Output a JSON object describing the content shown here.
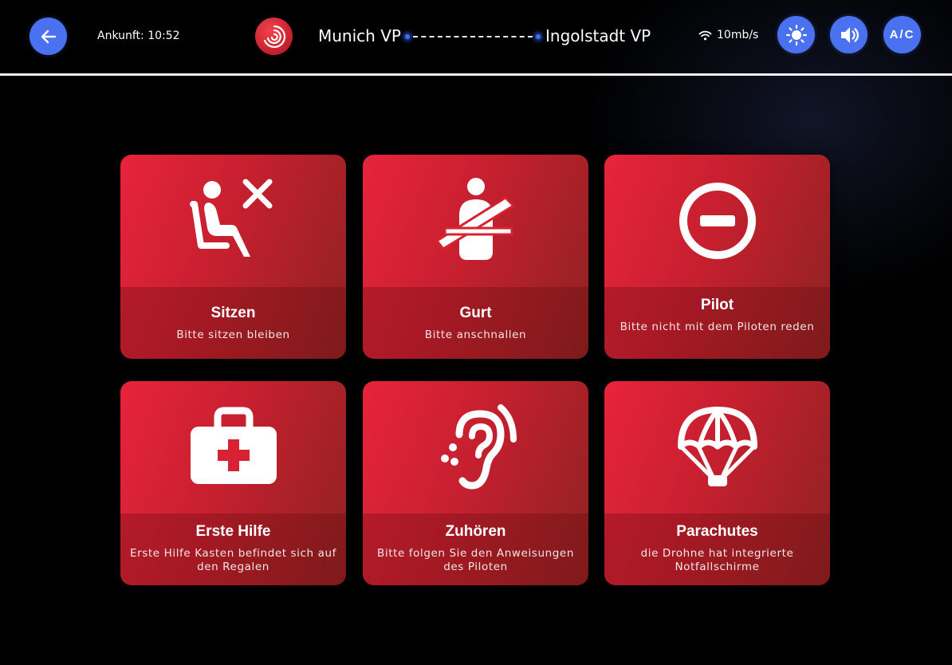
{
  "header": {
    "arrival": "Ankunft: 10:52",
    "route_from": "Munich VP",
    "route_to": "Ingolstadt VP",
    "connection_speed": "10mb/s",
    "ac_label": "A/C",
    "accent_color": "#4a72f0"
  },
  "cards": [
    {
      "title": "Sitzen",
      "description": "Bitte sitzen bleiben",
      "icon": "seated-person-no-icon"
    },
    {
      "title": "Gurt",
      "description": "Bitte anschnallen",
      "icon": "seatbelt-icon"
    },
    {
      "title": "Pilot",
      "description": "Bitte nicht mit dem Piloten reden",
      "icon": "do-not-enter-icon"
    },
    {
      "title": "Erste Hilfe",
      "description": "Erste Hilfe Kasten befindet sich auf den Regalen",
      "icon": "first-aid-kit-icon"
    },
    {
      "title": "Zuhören",
      "description": "Bitte folgen Sie den Anweisungen des Piloten",
      "icon": "ear-icon"
    },
    {
      "title": "Parachutes",
      "description": "die Drohne hat integrierte Notfallschirme",
      "icon": "parachute-icon"
    }
  ]
}
